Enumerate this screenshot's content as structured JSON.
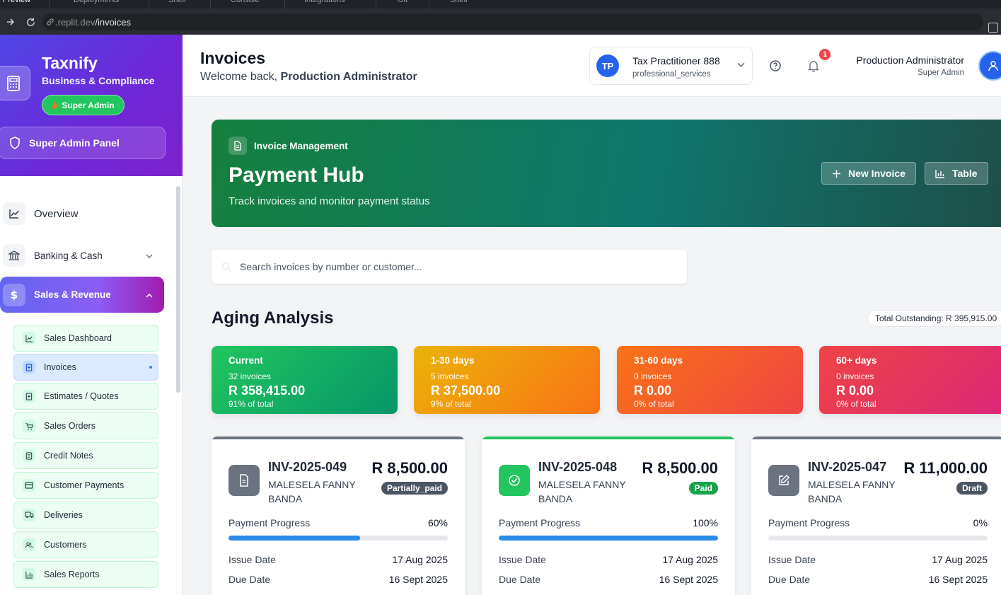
{
  "browser": {
    "tabs": [
      "Preview",
      "Deployments",
      "Shell",
      "Console",
      "Integrations",
      "Git",
      "Shell"
    ],
    "url_host": ".replit.dev",
    "url_path": "/invoices"
  },
  "sidebar": {
    "brand_name": "Taxnify",
    "brand_sub": "Business & Compliance",
    "role_badge": "Super Admin",
    "admin_panel": "Super Admin Panel",
    "items": [
      {
        "label": "Overview",
        "icon": "chart-line-icon"
      },
      {
        "label": "Banking & Cash",
        "icon": "bank-icon"
      },
      {
        "label": "Sales & Revenue",
        "icon": "dollar-icon"
      }
    ],
    "sales_items": [
      {
        "label": "Sales Dashboard",
        "icon": "chart-line-icon"
      },
      {
        "label": "Invoices",
        "icon": "document-icon"
      },
      {
        "label": "Estimates / Quotes",
        "icon": "document-icon"
      },
      {
        "label": "Sales Orders",
        "icon": "cart-icon"
      },
      {
        "label": "Credit Notes",
        "icon": "document-icon"
      },
      {
        "label": "Customer Payments",
        "icon": "card-icon"
      },
      {
        "label": "Deliveries",
        "icon": "truck-icon"
      },
      {
        "label": "Customers",
        "icon": "users-icon"
      },
      {
        "label": "Sales Reports",
        "icon": "bar-chart-icon"
      }
    ]
  },
  "header": {
    "title": "Invoices",
    "welcome_prefix": "Welcome back, ",
    "welcome_name": "Production Administrator",
    "company_initials": "TP",
    "company_name": "Tax Practitioner 888",
    "company_type": "professional_services",
    "notification_count": "1",
    "user_name": "Production Administrator",
    "user_role": "Super Admin"
  },
  "hero": {
    "tag": "Invoice Management",
    "title": "Payment Hub",
    "subtitle": "Track invoices and monitor payment status",
    "new_invoice": "New Invoice",
    "table": "Table"
  },
  "search": {
    "placeholder": "Search invoices by number or customer..."
  },
  "aging": {
    "title": "Aging Analysis",
    "total_outstanding": "Total Outstanding: R 395,915.00",
    "buckets": [
      {
        "label": "Current",
        "count": "32 invoices",
        "amount": "R 358,415.00",
        "pct": "91% of total",
        "gradient_from": "#22c55e",
        "gradient_to": "#059669"
      },
      {
        "label": "1-30 days",
        "count": "5 invoices",
        "amount": "R 37,500.00",
        "pct": "9% of total",
        "gradient_from": "#eab308",
        "gradient_to": "#f97316"
      },
      {
        "label": "31-60 days",
        "count": "0 invoices",
        "amount": "R 0.00",
        "pct": "0% of total",
        "gradient_from": "#f97316",
        "gradient_to": "#ef4444"
      },
      {
        "label": "60+ days",
        "count": "0 invoices",
        "amount": "R 0.00",
        "pct": "0% of total",
        "gradient_from": "#ef4444",
        "gradient_to": "#db2777"
      }
    ]
  },
  "invoices": [
    {
      "number": "INV-2025-049",
      "customer": "MALESELA FANNY BANDA",
      "amount": "R 8,500.00",
      "status": "Partially_paid",
      "status_color": "#4b5563",
      "accent": "#6b7280",
      "icon": "document-icon",
      "progress_label": "Payment Progress",
      "progress_text": "60%",
      "progress": 0.6,
      "issue_label": "Issue Date",
      "issue_date": "17 Aug 2025",
      "due_label": "Due Date",
      "due_date": "16 Sept 2025"
    },
    {
      "number": "INV-2025-048",
      "customer": "MALESELA FANNY BANDA",
      "amount": "R 8,500.00",
      "status": "Paid",
      "status_color": "#16a34a",
      "accent": "#22c55e",
      "icon": "check-circle-icon",
      "progress_label": "Payment Progress",
      "progress_text": "100%",
      "progress": 1.0,
      "issue_label": "Issue Date",
      "issue_date": "17 Aug 2025",
      "due_label": "Due Date",
      "due_date": "16 Sept 2025"
    },
    {
      "number": "INV-2025-047",
      "customer": "MALESELA FANNY BANDA",
      "amount": "R 11,000.00",
      "status": "Draft",
      "status_color": "#4b5563",
      "accent": "#6b7280",
      "icon": "edit-icon",
      "progress_label": "Payment Progress",
      "progress_text": "0%",
      "progress": 0.0,
      "issue_label": "Issue Date",
      "issue_date": "17 Aug 2025",
      "due_label": "Due Date",
      "due_date": "16 Sept 2025"
    }
  ]
}
